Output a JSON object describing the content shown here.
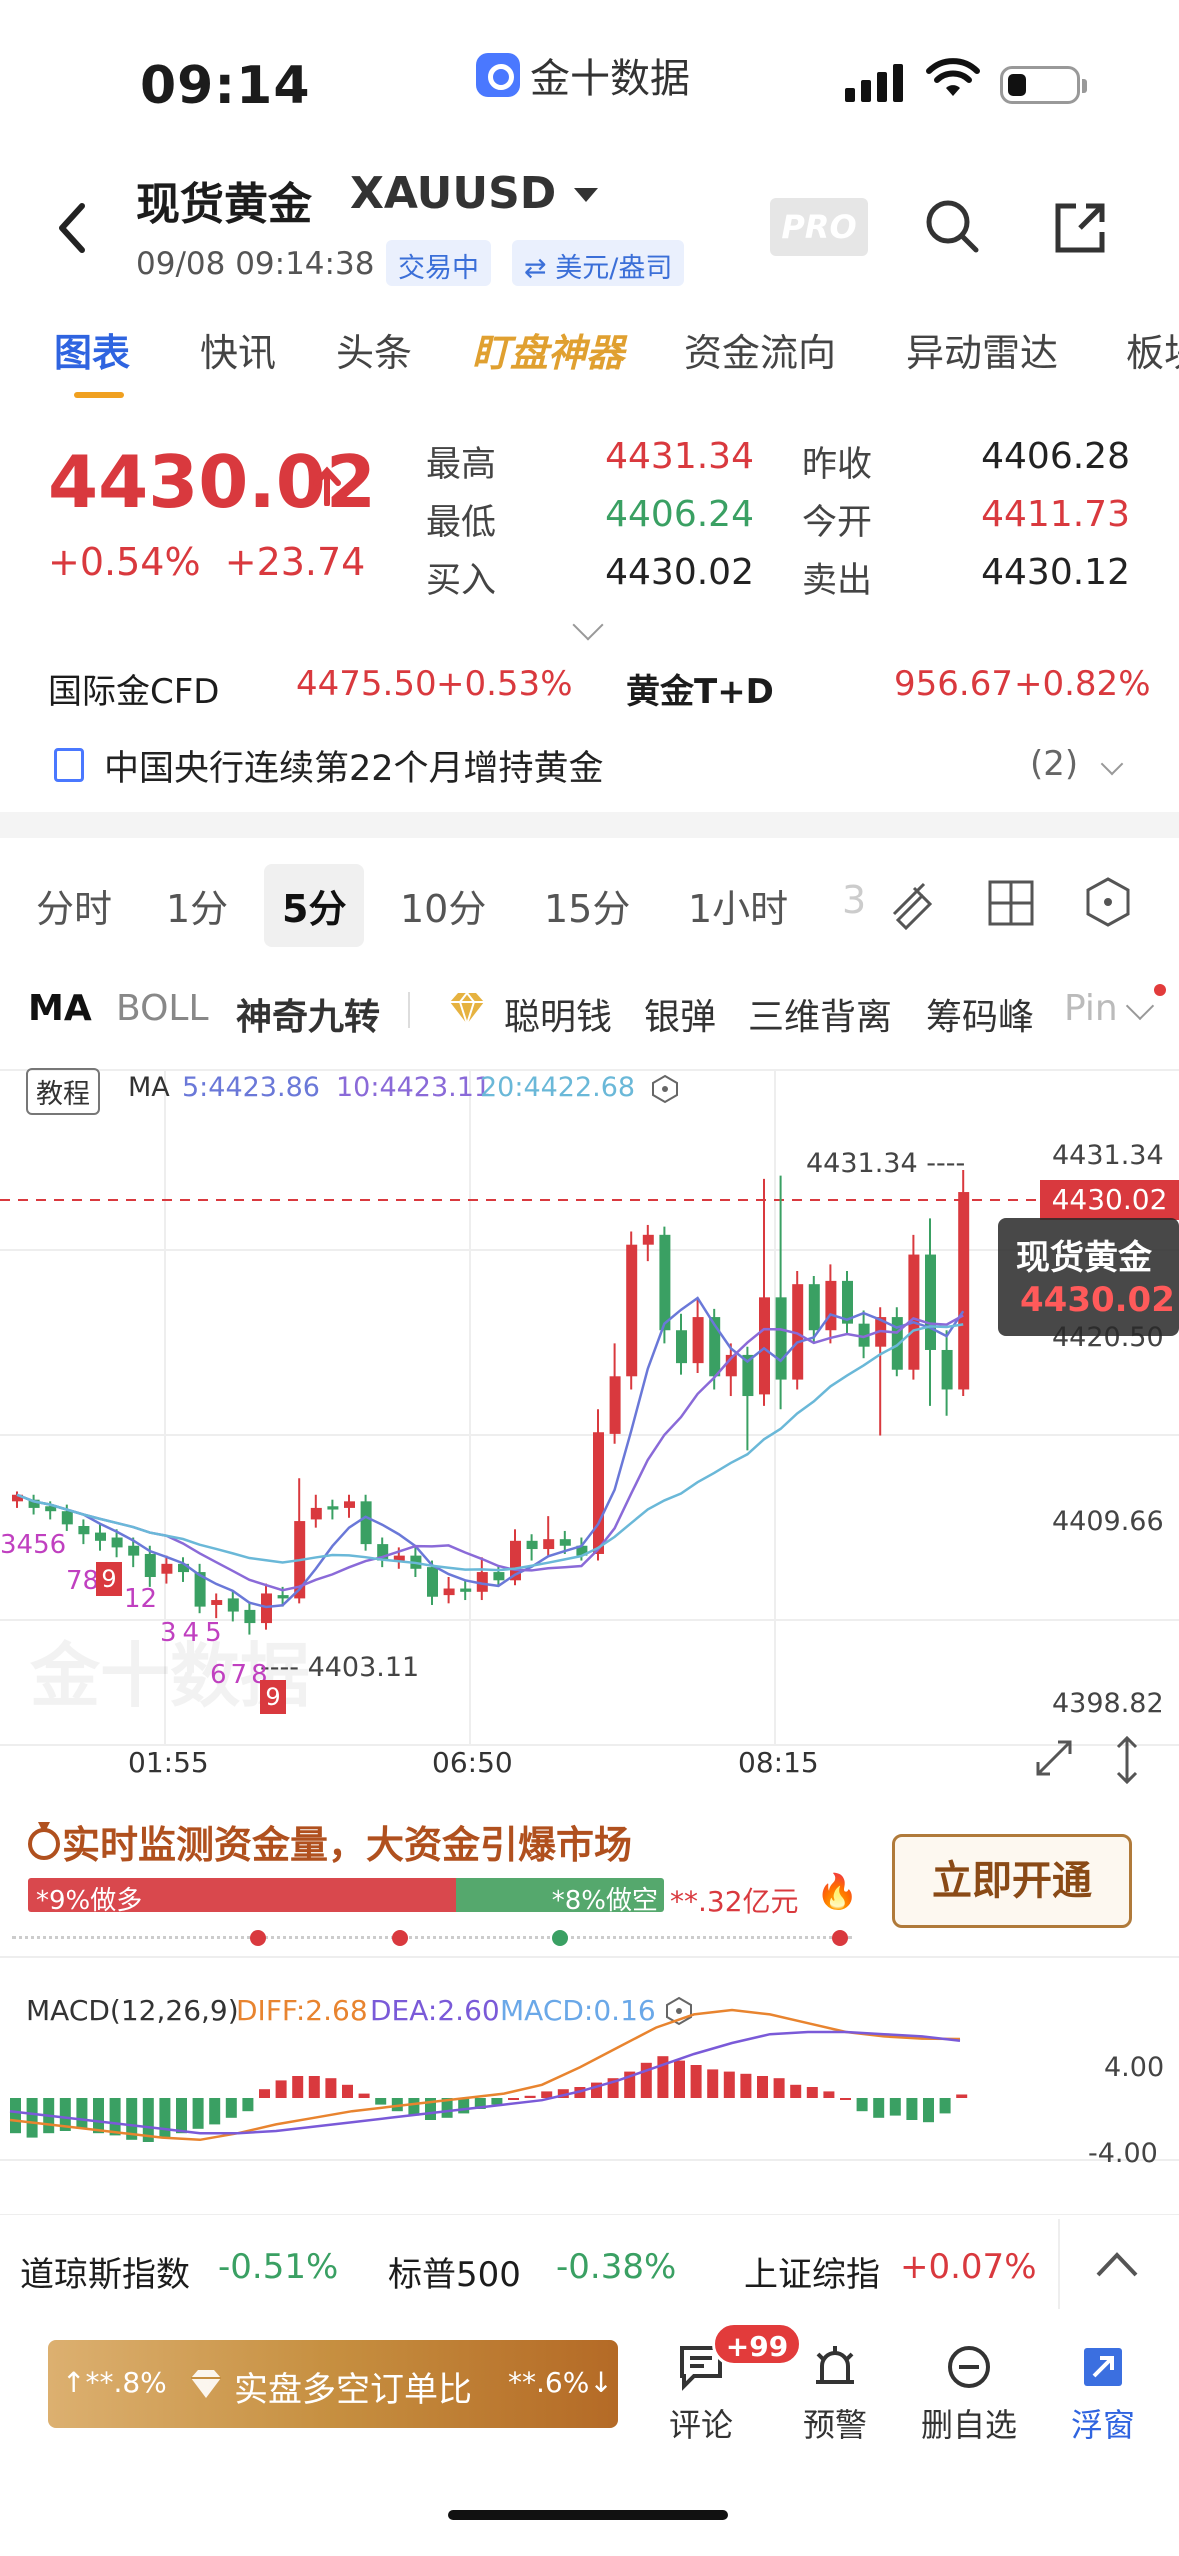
{
  "status_bar": {
    "time": "09:14",
    "app_name": "金十数据"
  },
  "header": {
    "name": "现货黄金",
    "code": "XAUUSD",
    "datetime": "09/08 09:14:38",
    "status": "交易中",
    "unit": "美元/盎司",
    "pro": "PRO"
  },
  "tabs": [
    "图表",
    "快讯",
    "头条",
    "盯盘神器",
    "资金流向",
    "异动雷达",
    "板块"
  ],
  "quote": {
    "price": "4430.02",
    "pct": "+0.54%",
    "change": "+23.74",
    "rows": [
      {
        "l1": "最高",
        "v1": "4431.34",
        "c1": "red",
        "l2": "昨收",
        "v2": "4406.28",
        "c2": "dark"
      },
      {
        "l1": "最低",
        "v1": "4406.24",
        "c1": "green",
        "l2": "今开",
        "v2": "4411.73",
        "c2": "red"
      },
      {
        "l1": "买入",
        "v1": "4430.02",
        "c1": "dark",
        "l2": "卖出",
        "v2": "4430.12",
        "c2": "dark"
      }
    ]
  },
  "related": [
    {
      "name": "国际金CFD",
      "price": "4475.50",
      "pct": "+0.53%"
    },
    {
      "name": "黄金T+D",
      "price": "956.67",
      "pct": "+0.82%"
    }
  ],
  "news": {
    "text": "中国央行连续第22个月增持黄金",
    "count": "(2)"
  },
  "timeframes": [
    "分时",
    "1分",
    "5分",
    "10分",
    "15分",
    "1小时",
    "3"
  ],
  "indicators": [
    "MA",
    "BOLL",
    "神奇九转",
    "聪明钱",
    "银弹",
    "三维背离",
    "筹码峰",
    "Pin"
  ],
  "chart": {
    "tutorial": "教程",
    "ma_label": "MA",
    "ma5": "5:4423.86",
    "ma10": "10:4423.11",
    "ma20": "20:4422.68",
    "price_axis": [
      "4431.34",
      "4420.50",
      "4409.66",
      "4398.82"
    ],
    "current_tag": "4430.02",
    "tooltip_name": "现货黄金",
    "tooltip_price": "4430.02",
    "high_mark": "4431.34",
    "low_mark": "4403.11",
    "time_axis": [
      "01:55",
      "06:50",
      "08:15"
    ],
    "watermark": "金十数据",
    "colors": {
      "up": "#d9393e",
      "down": "#3aa063",
      "ma5": "#6a78d8",
      "ma10": "#8a6ad8",
      "ma20": "#6ab8d8"
    },
    "nine_labels_a": "3456",
    "nine_labels_b": "78",
    "nine_labels_c": "12",
    "nine_labels_d": "345",
    "nine_labels_e": "678",
    "nine_box1": "9",
    "nine_box2": "9"
  },
  "promo": {
    "title": "实时监测资金量，大资金引爆市场",
    "long": "*9%做多",
    "short": "*8%做空",
    "amount": "**.32亿元",
    "button": "立即开通"
  },
  "macd": {
    "label": "MACD(12,26,9)",
    "diff": "DIFF:2.68",
    "dea": "DEA:2.60",
    "macd": "MACD:0.16",
    "axis_top": "4.00",
    "axis_bottom": "-4.00"
  },
  "indices": [
    {
      "name": "道琼斯指数",
      "pct": "-0.51%",
      "color": "green"
    },
    {
      "name": "标普500",
      "pct": "-0.38%",
      "color": "green"
    },
    {
      "name": "上证综指",
      "pct": "+0.07%",
      "color": "red"
    }
  ],
  "bottom": {
    "left_pct": "**.8%",
    "ratio_label": "实盘多空订单比",
    "right_pct": "**.6%",
    "nav": [
      {
        "label": "评论",
        "badge": "+99"
      },
      {
        "label": "预警"
      },
      {
        "label": "删自选"
      },
      {
        "label": "浮窗"
      }
    ]
  }
}
